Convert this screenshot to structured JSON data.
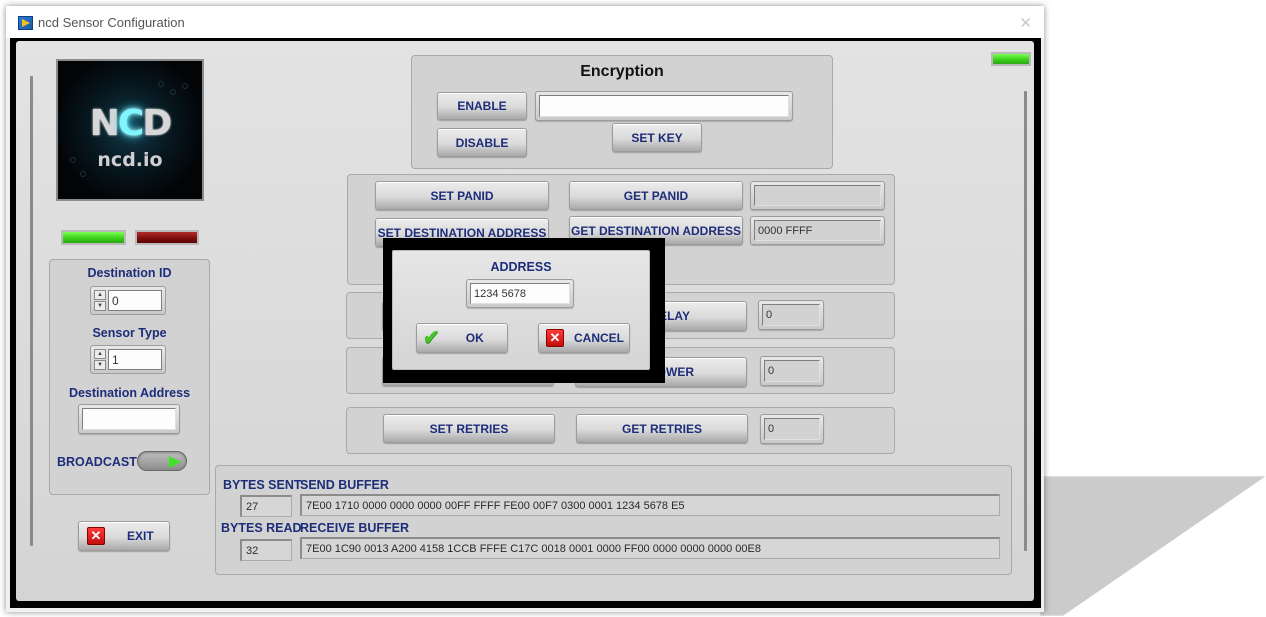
{
  "window": {
    "title": "ncd Sensor Configuration",
    "app_icon": "labview-icon",
    "close_icon": "close-icon"
  },
  "logo": {
    "brand": "NCD",
    "subtitle": "ncd.io"
  },
  "status_leds": [
    {
      "name": "left-green-led",
      "state": "on",
      "color": "#3bd11a"
    },
    {
      "name": "left-red-led",
      "state": "on",
      "color": "#7a0b0b"
    },
    {
      "name": "top-right-green-led",
      "state": "on",
      "color": "#3bd11a"
    }
  ],
  "left_panel": {
    "destination_id": {
      "label": "Destination ID",
      "value": "0"
    },
    "sensor_type": {
      "label": "Sensor Type",
      "value": "1"
    },
    "destination_address": {
      "label": "Destination Address",
      "value": ""
    },
    "broadcast": {
      "label": "BROADCAST",
      "state": "on"
    }
  },
  "exit_button": {
    "label": "EXIT",
    "icon": "x-icon"
  },
  "encryption": {
    "title": "Encryption",
    "enable_label": "ENABLE",
    "disable_label": "DISABLE",
    "key_value": "",
    "set_key_label": "SET KEY"
  },
  "panid_group": {
    "set_panid_label": "SET PANID",
    "get_panid_label": "GET PANID",
    "panid_value": "",
    "set_dest_label": "SET DESTINATION ADDRESS",
    "get_dest_label": "GET DESTINATION ADDRESS",
    "dest_value": "0000 FFFF"
  },
  "delay_group": {
    "get_label_visible": "ELAY",
    "value": "0"
  },
  "power_group": {
    "get_label_visible": "OWER",
    "value": "0"
  },
  "retries_group": {
    "set_label": "SET RETRIES",
    "get_label": "GET RETRIES",
    "value": "0"
  },
  "buffers": {
    "bytes_sent_label": "BYTES SENT",
    "bytes_sent": "27",
    "send_buffer_label": "SEND BUFFER",
    "send_buffer": "7E00 1710 0000 0000 0000 00FF FFFF FE00 00F7 0300 0001 1234 5678 E5",
    "bytes_read_label": "BYTES READ",
    "bytes_read": "32",
    "receive_buffer_label": "RECEIVE BUFFER",
    "receive_buffer": "7E00 1C90 0013 A200 4158 1CCB FFFE C17C 0018 0001 0000 FF00 0000 0000 0000 00E8"
  },
  "dialog": {
    "label": "ADDRESS",
    "value": "1234 5678",
    "ok_label": "OK",
    "ok_icon": "checkmark-icon",
    "cancel_label": "CANCEL",
    "cancel_icon": "x-icon"
  }
}
